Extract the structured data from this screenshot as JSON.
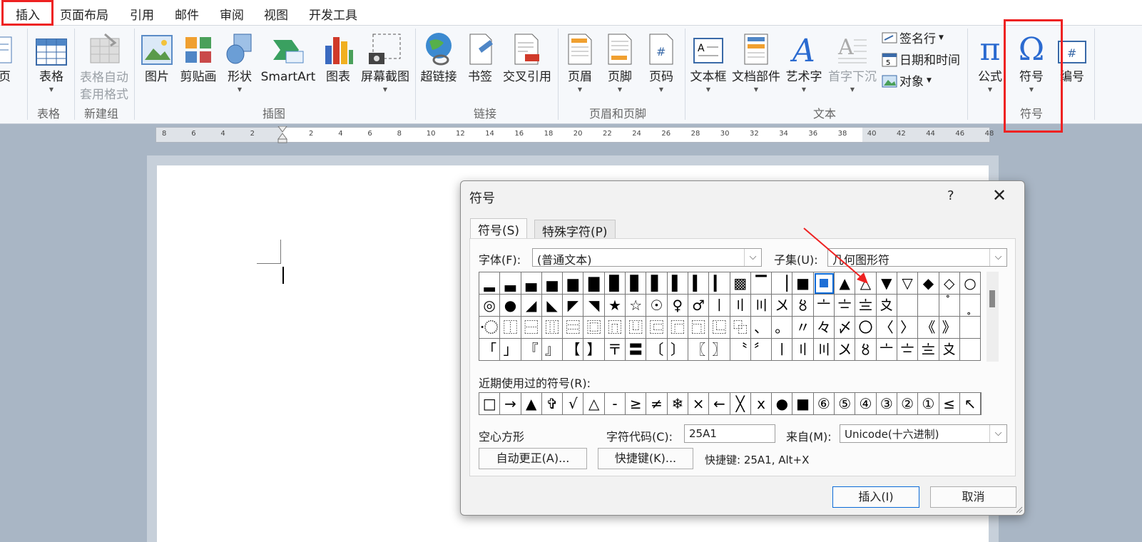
{
  "tabs": [
    "插入",
    "页面布局",
    "引用",
    "邮件",
    "审阅",
    "视图",
    "开发工具"
  ],
  "ribbon": {
    "partial_label": "分页",
    "items": {
      "table": "表格",
      "table_autofmt": "表格自动\n套用格式",
      "picture": "图片",
      "clipart": "剪贴画",
      "shapes": "形状",
      "smartart": "SmartArt",
      "chart": "图表",
      "screenshot": "屏幕截图",
      "hyperlink": "超链接",
      "bookmark": "书签",
      "crossref": "交叉引用",
      "header": "页眉",
      "footer": "页脚",
      "pagenum": "页码",
      "textbox": "文本框",
      "quickparts": "文档部件",
      "wordart": "艺术字",
      "dropcap": "首字下沉",
      "signature": "签名行",
      "datetime": "日期和时间",
      "object": "对象",
      "equation": "公式",
      "symbol": "符号",
      "numbering": "编号"
    },
    "groups": {
      "tables": "表格",
      "newgroup": "新建组",
      "illustrations": "插图",
      "links": "链接",
      "headerfooter": "页眉和页脚",
      "text": "文本",
      "symbols": "符号"
    }
  },
  "ruler": [
    "8",
    "6",
    "4",
    "2",
    "",
    "2",
    "4",
    "6",
    "8",
    "10",
    "12",
    "14",
    "16",
    "18",
    "20",
    "22",
    "24",
    "26",
    "28",
    "30",
    "32",
    "34",
    "36",
    "38",
    "40",
    "42",
    "44",
    "46",
    "48"
  ],
  "dialog": {
    "title": "符号",
    "help": "?",
    "close": "✕",
    "tab_symbols": "符号(S)",
    "tab_special": "特殊字符(P)",
    "font_label": "字体(F):",
    "font_value": "(普通文本)",
    "subset_label": "子集(U):",
    "subset_value": "几何图形符",
    "grid_rows": [
      [
        "▂",
        "▃",
        "▄",
        "▅",
        "▆",
        "▇",
        "▉",
        "▊",
        "▋",
        "▌",
        "▍",
        "▎",
        "▩",
        "▔",
        "▕",
        "■",
        "□",
        "▲",
        "△",
        "▼",
        "▽",
        "◆",
        "◇",
        "○"
      ],
      [
        "◎",
        "●",
        "◢",
        "◣",
        "◤",
        "◥",
        "★",
        "☆",
        "☉",
        "♀",
        "♂",
        "〡",
        "〢",
        "〣",
        "〤",
        "〥",
        "〦",
        "〧",
        "〨",
        "〩",
        "〪",
        "〫",
        "〬",
        "〭"
      ],
      [
        "〮",
        "⿰",
        "⿱",
        "⿲",
        "⿳",
        "⿴",
        "⿵",
        "⿶",
        "⿷",
        "⿸",
        "⿹",
        "⿺",
        "⿻",
        "、",
        "。",
        "〃",
        "々",
        "〆",
        "〇",
        "〈",
        "〉",
        "《",
        "》",
        ""
      ],
      [
        "「",
        "」",
        "『",
        "』",
        "【",
        "】",
        "〒",
        "〓",
        "〔",
        "〕",
        "〖",
        "〗",
        "〝",
        "〞",
        "〡",
        "〢",
        "〣",
        "〤",
        "〥",
        "〦",
        "〧",
        "〨",
        "〩",
        "〪"
      ]
    ],
    "recent_label": "近期使用过的符号(R):",
    "recent": [
      "□",
      "→",
      "▲",
      "✞",
      "√",
      "△",
      "-",
      "≥",
      "≠",
      "❄",
      "×",
      "←",
      "╳",
      "x",
      "●",
      "■",
      "⑥",
      "⑤",
      "④",
      "③",
      "②",
      "①",
      "≤",
      "↖"
    ],
    "char_name": "空心方形",
    "code_label": "字符代码(C):",
    "code_value": "25A1",
    "from_label": "来自(M):",
    "from_value": "Unicode(十六进制)",
    "autocorrect": "自动更正(A)...",
    "shortcut_btn": "快捷键(K)...",
    "shortcut_text": "快捷键: 25A1, Alt+X",
    "insert": "插入(I)",
    "cancel": "取消"
  }
}
